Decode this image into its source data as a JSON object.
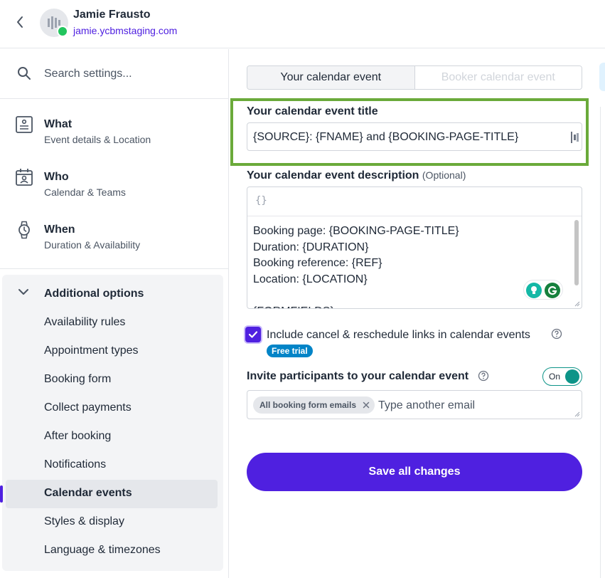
{
  "header": {
    "name": "Jamie Frausto",
    "link": "jamie.ycbmstaging.com"
  },
  "search": {
    "placeholder": "Search settings..."
  },
  "nav": {
    "what": {
      "title": "What",
      "subtitle": "Event details & Location"
    },
    "who": {
      "title": "Who",
      "subtitle": "Calendar & Teams"
    },
    "when": {
      "title": "When",
      "subtitle": "Duration & Availability"
    }
  },
  "additional": {
    "label": "Additional options",
    "items": [
      {
        "label": "Availability rules"
      },
      {
        "label": "Appointment types"
      },
      {
        "label": "Booking form"
      },
      {
        "label": "Collect payments"
      },
      {
        "label": "After booking"
      },
      {
        "label": "Notifications"
      },
      {
        "label": "Calendar events",
        "active": true
      },
      {
        "label": "Styles & display"
      },
      {
        "label": "Language & timezones"
      }
    ]
  },
  "tabs": {
    "your": "Your calendar event",
    "booker": "Booker calendar event"
  },
  "title_field": {
    "label": "Your calendar event title",
    "value": "{SOURCE}: {FNAME} and {BOOKING-PAGE-TITLE}"
  },
  "description": {
    "label": "Your calendar event description",
    "optional": "(Optional)",
    "toolbar": "{}",
    "text": "Booking page: {BOOKING-PAGE-TITLE}\nDuration: {DURATION}\nBooking reference: {REF}\nLocation: {LOCATION}\n\n{FORMFIELDS}"
  },
  "cancel_links": {
    "label": "Include cancel & reschedule links in calendar events",
    "badge": "Free trial",
    "checked": true
  },
  "invite": {
    "label": "Invite participants to your calendar event",
    "toggle": "On",
    "chip": "All booking form emails",
    "placeholder": "Type another email"
  },
  "save_label": "Save all changes",
  "colors": {
    "accent": "#4f20e0",
    "highlight": "#6aaa3a",
    "toggle": "#0d9488",
    "badge": "#0284c7"
  }
}
